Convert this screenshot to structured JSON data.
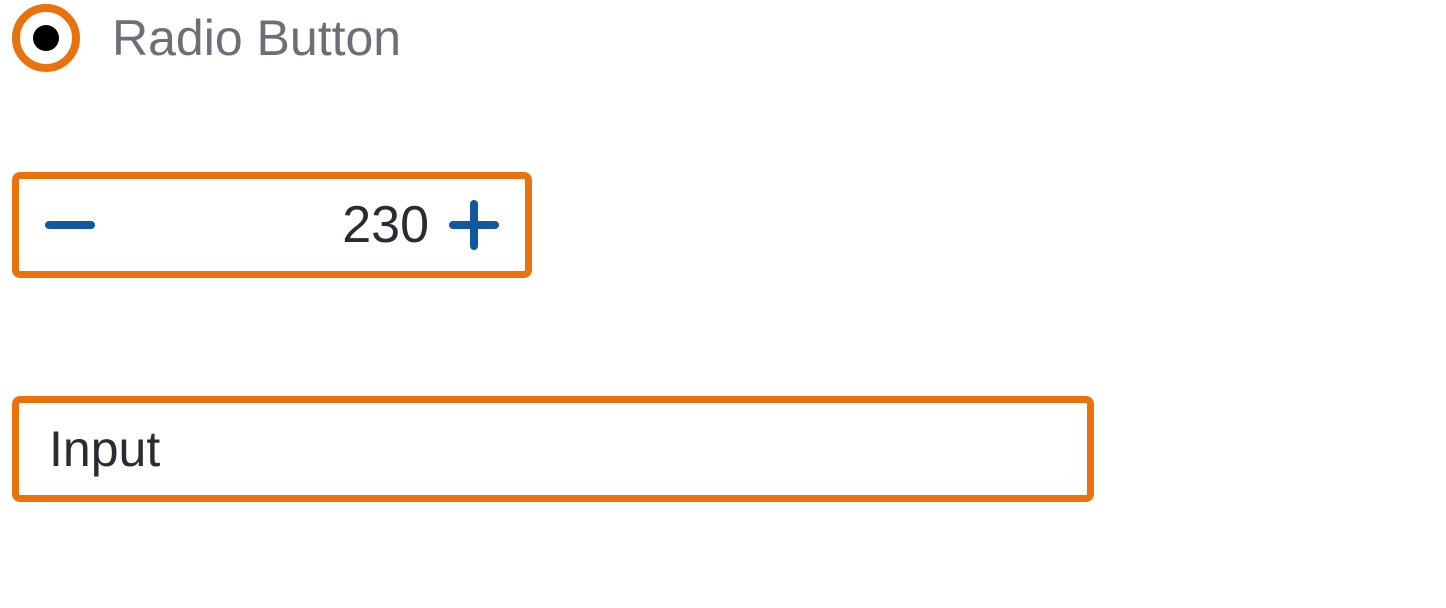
{
  "radio": {
    "label": "Radio Button",
    "checked": true
  },
  "stepper": {
    "value": "230"
  },
  "input": {
    "placeholder": "Input",
    "value": ""
  },
  "colors": {
    "accent": "#E9720C",
    "stepper_icon": "#12589E",
    "text_muted": "#6E6E78",
    "text": "#2B2B33"
  }
}
